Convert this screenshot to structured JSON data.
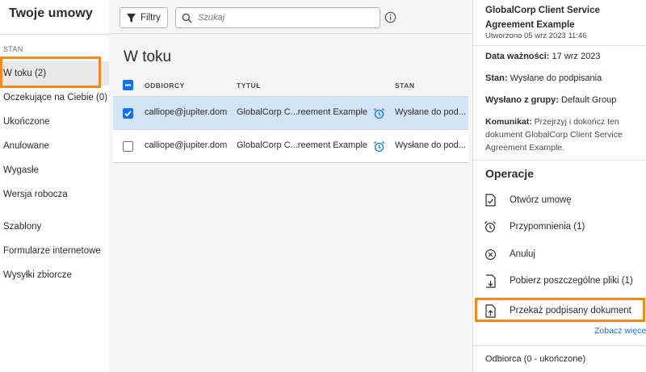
{
  "sidebar": {
    "title": "Twoje umowy",
    "section_label": "STAN",
    "status_items": [
      {
        "label": "W toku (2)"
      },
      {
        "label": "Oczekujące na Ciebie (0)"
      },
      {
        "label": "Ukończone"
      },
      {
        "label": "Anulowane"
      },
      {
        "label": "Wygasłe"
      },
      {
        "label": "Wersja robocza"
      }
    ],
    "other_items": [
      {
        "label": "Szablony"
      },
      {
        "label": "Formularze internetowe"
      },
      {
        "label": "Wysyłki zbiorcze"
      }
    ]
  },
  "toolbar": {
    "filter_label": "Filtry",
    "search_placeholder": "Szukaj"
  },
  "main": {
    "title": "W toku",
    "columns": {
      "recipients": "ODBIORCY",
      "title": "TYTUŁ",
      "status": "STAN"
    },
    "rows": [
      {
        "recipient": "calliope@jupiter.dom",
        "title": "GlobalCorp C...reement Example",
        "status": "Wysłane do pod...",
        "selected": true
      },
      {
        "recipient": "calliope@jupiter.dom",
        "title": "GlobalCorp C...reement Example",
        "status": "Wysłane do pod...",
        "selected": false
      }
    ]
  },
  "panel": {
    "doc_title": "GlobalCorp Client Service Agreement Example",
    "created": "Utworzono 05 wrz 2023 11:46",
    "expiry_label": "Data ważności:",
    "expiry_value": "17 wrz 2023",
    "status_label": "Stan:",
    "status_value": "Wysłane do podpisania",
    "group_label": "Wysłano z grupy:",
    "group_value": "Default Group",
    "message_label": "Komunikat:",
    "message_value": "Przejrzyj i dokończ ten dokument GlobalCorp Client Service Agreement Example.",
    "operations_title": "Operacje",
    "operations": [
      {
        "label": "Otwórz umowę",
        "icon": "open-document-icon"
      },
      {
        "label": "Przypomnienia (1)",
        "icon": "alarm-clock-icon"
      },
      {
        "label": "Anuluj",
        "icon": "cancel-circle-icon"
      },
      {
        "label": "Pobierz poszczególne pliki (1)",
        "icon": "download-file-icon"
      },
      {
        "label": "Przekaż podpisany dokument",
        "icon": "upload-file-icon"
      }
    ],
    "see_more": "Zobacz więcej",
    "recipient_summary": "Odbiorca (0 - ukończone)"
  },
  "colors": {
    "accent": "#1473e6",
    "highlight": "#f08a24",
    "selected_row": "#d4e4f7"
  }
}
